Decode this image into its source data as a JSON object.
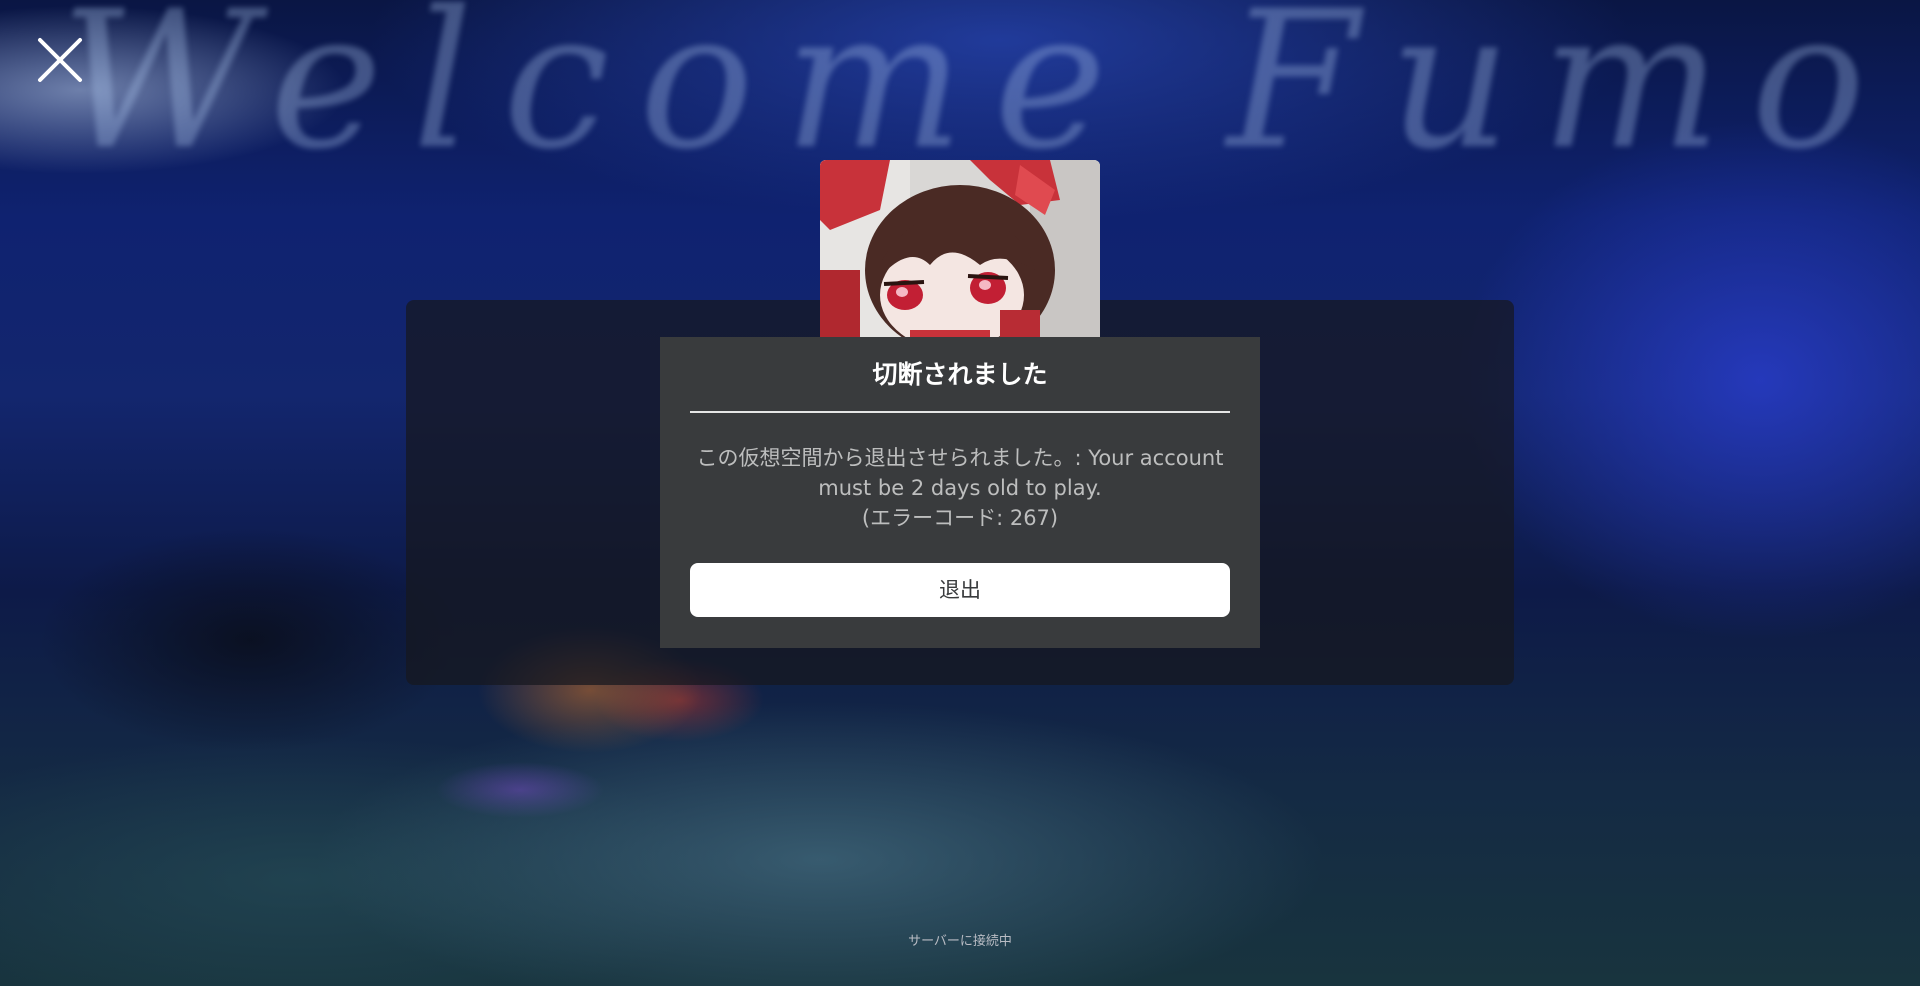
{
  "background": {
    "script_text": "Welcome Fumo"
  },
  "close_button": {
    "icon": "close-icon",
    "color": "#ffffff"
  },
  "thumbnail": {
    "description_icon": "game-thumbnail-image"
  },
  "dialog": {
    "title": "切断されました",
    "message_line1": "この仮想空間から退出させられました。: Your account",
    "message_line2": "must be 2 days old to play.",
    "error_code": "(エラーコード: 267)",
    "exit_button_label": "退出"
  },
  "status": {
    "text": "サーバーに接続中"
  },
  "colors": {
    "dialog_bg": "#393b3d",
    "dialog_title": "#ffffff",
    "dialog_text": "#bdbebe",
    "button_bg": "#ffffff",
    "button_text": "#393b3d"
  }
}
